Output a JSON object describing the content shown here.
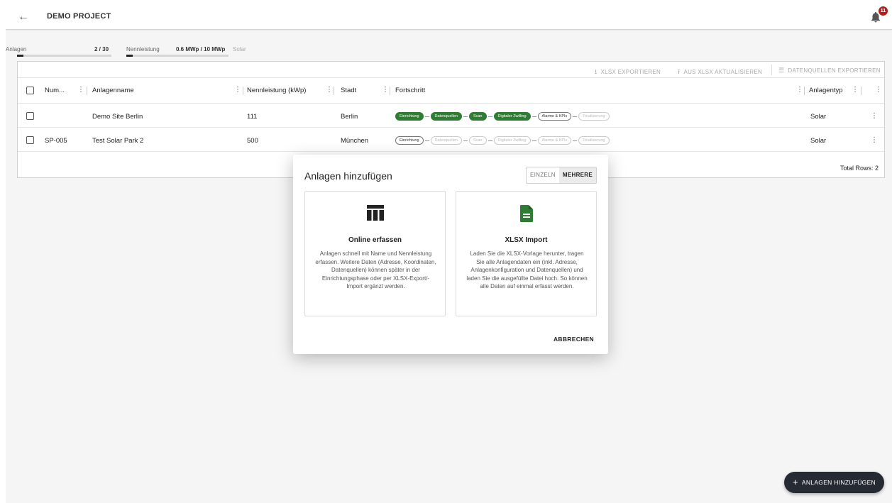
{
  "header": {
    "project_name": "DEMO PROJECT",
    "notification_count": "11"
  },
  "stats": {
    "anlagen_label": "Anlagen",
    "anlagen_value": "2 / 30",
    "anlagen_progress": 0.0667,
    "nennleistung_label": "Nennleistung",
    "nennleistung_value": "0.6 MWp / 10 MWp",
    "nennleistung_progress": 0.06,
    "type_label": "Solar"
  },
  "toolbar": {
    "export_xlsx": "XLSX EXPORTIEREN",
    "update_xlsx": "AUS XLSX AKTUALISIEREN",
    "export_datasources": "DATENQUELLEN EXPORTIEREN"
  },
  "table": {
    "columns": {
      "num": "Num...",
      "name": "Anlagenname",
      "power": "Nennleistung (kWp)",
      "city": "Stadt",
      "progress": "Fortschritt",
      "type": "Anlagentyp"
    },
    "rows": [
      {
        "num": "",
        "name": "Demo Site Berlin",
        "power": "111",
        "city": "Berlin",
        "type": "Solar",
        "steps_done": 4
      },
      {
        "num": "SP-005",
        "name": "Test Solar Park 2",
        "power": "500",
        "city": "München",
        "type": "Solar",
        "steps_done": 0
      }
    ],
    "steps": [
      "Einrichtung",
      "Datenquellen",
      "Scan",
      "Digitaler Zwilling",
      "Alarme & KPIs",
      "Finalisierung"
    ],
    "total_rows": "Total Rows: 2"
  },
  "modal": {
    "title": "Anlagen hinzufügen",
    "toggle_single": "EINZELN",
    "toggle_multiple": "MEHRERE",
    "option_online": {
      "title": "Online erfassen",
      "description": "Anlagen schnell mit Name und Nennleistung erfassen. Weitere Daten (Adresse, Koordinaten, Datenquellen) können später in der Einrichtungsphase oder per XLSX-Export/-Import ergänzt werden.",
      "icon": "table-icon"
    },
    "option_xlsx": {
      "title": "XLSX Import",
      "description": "Laden Sie die XLSX-Vorlage herunter, tragen Sie alle Anlagendaten ein (inkl. Adresse, Anlagenkonfiguration und Datenquellen) und laden Sie die ausgefüllte Datei hoch. So können alle Daten auf einmal erfasst werden.",
      "icon": "document-icon",
      "icon_color": "#2e7d32"
    },
    "cancel": "ABBRECHEN"
  },
  "fab": {
    "label": "ANLAGEN HINZUFÜGEN"
  }
}
